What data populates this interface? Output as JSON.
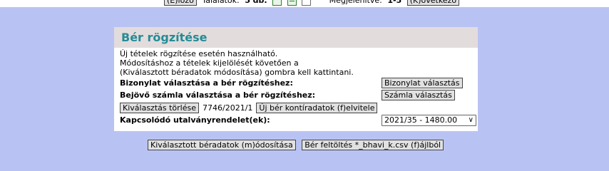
{
  "topbar": {
    "prev_label": "(E)lőző",
    "results_label": "Találatok:",
    "results_value": "5 db.",
    "shown_label": "Megjelenítve:",
    "shown_value": "1-5",
    "next_label": "(K)övetkező"
  },
  "panel": {
    "title": "Bér rögzítése",
    "info_lines": [
      "Új tételek rögzítése esetén használható.",
      "Módosításhoz a tételek kijelölését követően a",
      "(Kiválasztott béradatok módosítása) gombra kell kattintani."
    ],
    "voucher_label": "Bizonylat választása a bér rögzítéshez:",
    "voucher_button": "Bizonylat választás",
    "invoice_label": "Bejövő számla választása a bér rögzítéshez:",
    "invoice_button": "Számla választás",
    "clear_button": "Kiválasztás törlése",
    "selected_value": "7746/2021/1",
    "new_button": "Új bér kontíradatok (f)elvitele",
    "linked_label": "Kapcsolódó utalványrendelet(ek):",
    "linked_selected": "2021/35 - 1480.00"
  },
  "bottom": {
    "modify_button": "Kiválasztott béradatok (m)ódosítása",
    "upload_button": "Bér feltöltés *_bhavi_k.csv (f)ájlból"
  },
  "icons": [
    "excel-icon",
    "sheet-icon",
    "document-icon"
  ],
  "colors": {
    "background": "#b9c3f3",
    "title": "#248c97",
    "header_bg": "#e3dcdc"
  }
}
